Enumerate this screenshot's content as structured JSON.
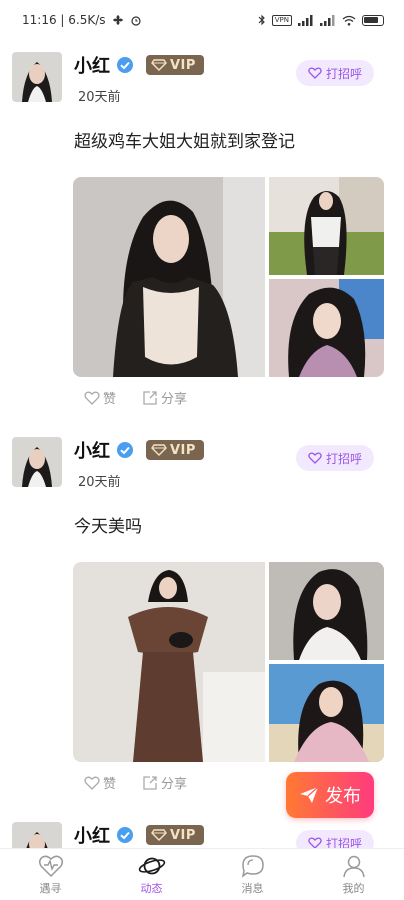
{
  "status_bar": {
    "time_speed": "11:16 | 6.5K/s",
    "vpn": "VPN",
    "battery_label": "battery-icon"
  },
  "posts": [
    {
      "name": "小红",
      "vip": "VIP",
      "time": "20天前",
      "greet": "打招呼",
      "content": "超级鸡车大姐大姐就到家登记",
      "like": "赞",
      "share": "分享"
    },
    {
      "name": "小红",
      "vip": "VIP",
      "time": "20天前",
      "greet": "打招呼",
      "content": "今天美吗",
      "like": "赞",
      "share": "分享"
    },
    {
      "name": "小红",
      "vip": "VIP",
      "greet": "打招呼"
    }
  ],
  "publish": {
    "label": "发布"
  },
  "tabs": [
    {
      "label": "遇寻",
      "icon": "heartbeat-icon"
    },
    {
      "label": "动态",
      "icon": "planet-icon"
    },
    {
      "label": "消息",
      "icon": "chat-bubble-icon"
    },
    {
      "label": "我的",
      "icon": "person-icon"
    }
  ],
  "colors": {
    "accent": "#a355e8",
    "greet_bg": "#f3e9ff",
    "vip_bg": "#7a6550",
    "publish_start": "#ff7a33",
    "publish_end": "#ff3b7e"
  }
}
